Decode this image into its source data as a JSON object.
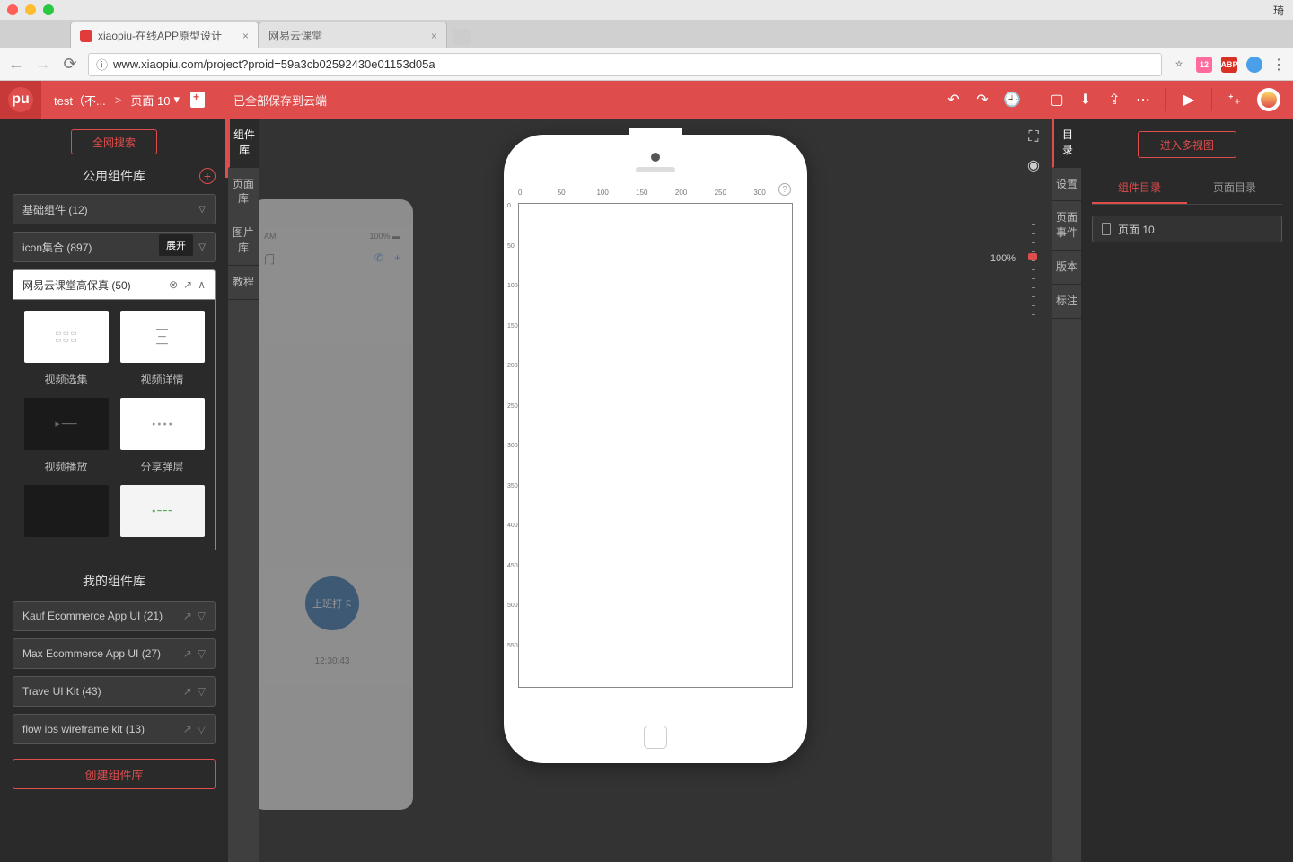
{
  "mac_user": "琦",
  "browser": {
    "tabs": [
      {
        "title": "xiaopiu-在线APP原型设计",
        "active": true
      },
      {
        "title": "网易云课堂",
        "active": false
      }
    ],
    "url": "www.xiaopiu.com/project?proid=59a3cb02592430e01153d05a",
    "ext_cal_badge": "12",
    "ext_abp": "ABP"
  },
  "appbar": {
    "project": "test（不...",
    "sep": ">",
    "page": "页面 10",
    "save_status": "已全部保存到云端"
  },
  "left": {
    "global_search": "全网搜索",
    "public_lib_title": "公用组件库",
    "rows": {
      "basic": "基础组件 (12)",
      "icons": "icon集合 (897)",
      "netease": "网易云课堂高保真 (50)"
    },
    "tooltip": "展开",
    "components": [
      "视频选集",
      "视频详情",
      "视频播放",
      "分享弹层"
    ],
    "my_lib_title": "我的组件库",
    "my_libs": [
      "Kauf Ecommerce App UI (21)",
      "Max Ecommerce App UI (27)",
      "Trave UI Kit (43)",
      "flow ios wireframe kit (13)"
    ],
    "create_lib": "创建组件库"
  },
  "mini_tabs_left": [
    "组件库",
    "页面库",
    "图片库",
    "教程"
  ],
  "canvas": {
    "zoom": "100%",
    "ruler_h": [
      "0",
      "50",
      "100",
      "150",
      "200",
      "250",
      "300"
    ],
    "ruler_v": [
      "0",
      "50",
      "100",
      "150",
      "200",
      "250",
      "300",
      "350",
      "400",
      "450",
      "500",
      "550"
    ],
    "ghost": {
      "time": "AM",
      "pct": "100%",
      "badge": "上班打卡",
      "clock": "12:30:43",
      "recent": "门"
    }
  },
  "mini_tabs_right": [
    "目录",
    "设置",
    "页面事件",
    "版本",
    "标注"
  ],
  "right": {
    "multi_view": "进入多视图",
    "tabs": {
      "comp": "组件目录",
      "page": "页面目录"
    },
    "page_item": "页面 10"
  }
}
